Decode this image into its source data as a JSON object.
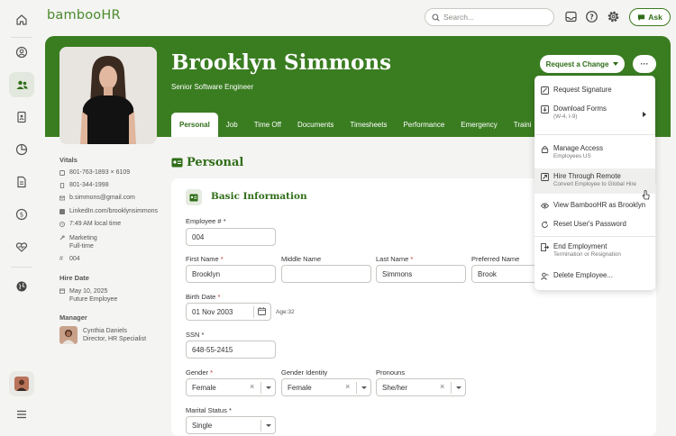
{
  "app": {
    "logo_text": "bambooHR"
  },
  "topbar": {
    "search_placeholder": "Search...",
    "ask_label": "Ask"
  },
  "employee": {
    "name": "Brooklyn Simmons",
    "title": "Senior Software Engineer"
  },
  "header_actions": {
    "request_change_label": "Request a Change",
    "more_label": "···"
  },
  "tabs": [
    {
      "label": "Personal",
      "active": true
    },
    {
      "label": "Job"
    },
    {
      "label": "Time Off"
    },
    {
      "label": "Documents"
    },
    {
      "label": "Timesheets"
    },
    {
      "label": "Performance"
    },
    {
      "label": "Emergency"
    },
    {
      "label": "Traini"
    }
  ],
  "sidebar": {
    "vitals_heading": "Vitals",
    "work_phone": "801-763-1893 × 6109",
    "mobile_phone": "801-344-1998",
    "email": "b.simmons@gmail.com",
    "linkedin": "LinkedIn.com/brooklynsimmons",
    "local_time": "7:49 AM local time",
    "department": "Marketing",
    "employment_type": "Full-time",
    "employee_number": "004",
    "hire_heading": "Hire Date",
    "hire_date": "May 10, 2025",
    "hire_status": "Future Employee",
    "manager_heading": "Manager",
    "manager_name": "Cynthia Daniels",
    "manager_title": "Director, HR Specialist"
  },
  "section": {
    "title": "Personal",
    "subsection_title": "Basic Information"
  },
  "form": {
    "employee_number": {
      "label": "Employee #",
      "value": "004"
    },
    "first_name": {
      "label": "First Name",
      "value": "Brooklyn"
    },
    "middle_name": {
      "label": "Middle Name",
      "value": ""
    },
    "last_name": {
      "label": "Last Name",
      "value": "Simmons"
    },
    "preferred_name": {
      "label": "Preferred Name",
      "value": "Brook"
    },
    "birth_date": {
      "label": "Birth Date",
      "value": "01 Nov 2003",
      "age_text": "Age:32"
    },
    "ssn": {
      "label": "SSN",
      "value": "648-55-2415"
    },
    "gender": {
      "label": "Gender",
      "value": "Female"
    },
    "gender_identity": {
      "label": "Gender Identity",
      "value": "Female"
    },
    "pronouns": {
      "label": "Pronouns",
      "value": "She/her"
    },
    "marital_status": {
      "label": "Marital Status",
      "value": "Single"
    },
    "required_mark": "*"
  },
  "menu": {
    "items": [
      {
        "label": "Request Signature",
        "icon": "signature-icon"
      },
      {
        "label": "Download Forms",
        "sub": "(W-4, I-9)",
        "icon": "download-forms-icon"
      },
      {
        "label": "Manage Access",
        "sub": "Employees US",
        "icon": "lock-icon"
      },
      {
        "label": "Hire Through Remote",
        "sub": "Convert Employee to Global Hire",
        "icon": "remote-icon",
        "hovered": true
      },
      {
        "label": "View BambooHR as Brooklyn",
        "icon": "eye-icon"
      },
      {
        "label": "Reset User's Password",
        "icon": "reset-icon"
      },
      {
        "label": "End Employment",
        "sub": "Termination or Resignation",
        "icon": "end-employment-icon"
      },
      {
        "label": "Delete Employee...",
        "icon": "delete-user-icon"
      }
    ]
  },
  "colors": {
    "brand_green": "#3a7d21",
    "text_green": "#2f6d18"
  }
}
